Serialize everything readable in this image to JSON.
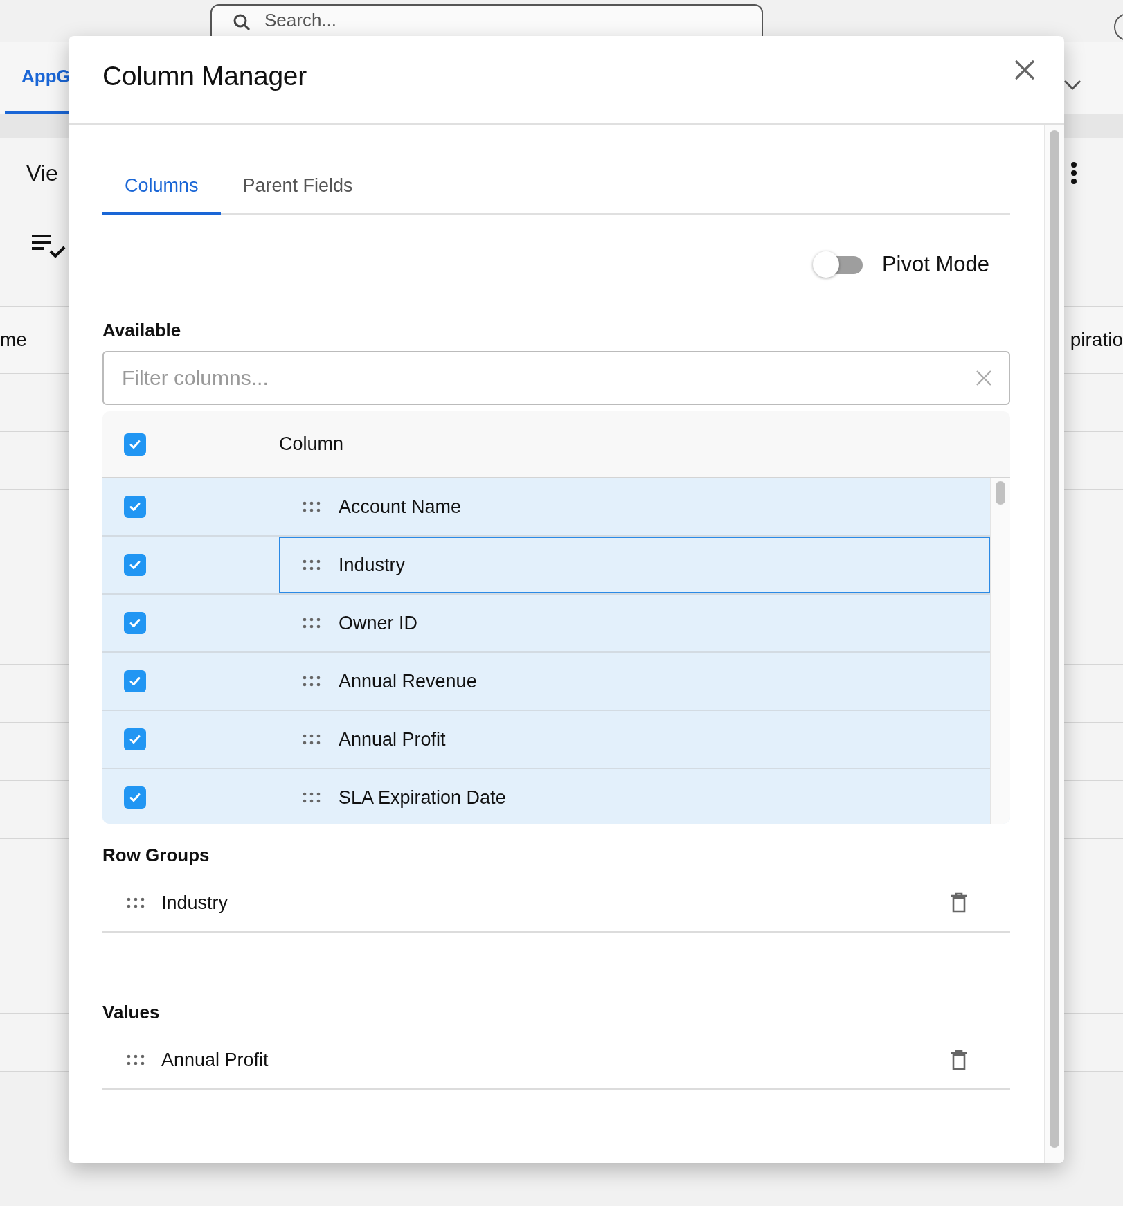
{
  "background": {
    "search": {
      "placeholder": "Search..."
    },
    "tab": {
      "label": "AppG",
      "selected": true
    },
    "toolbar_label": "Vie",
    "header_cells": [
      "me",
      "piratio"
    ]
  },
  "dialog": {
    "title": "Column Manager",
    "tabs": [
      {
        "label": "Columns",
        "selected": true
      },
      {
        "label": "Parent Fields",
        "selected": false
      }
    ],
    "pivot_mode": {
      "label": "Pivot Mode",
      "on": false
    },
    "available": {
      "label": "Available",
      "filter": {
        "placeholder": "Filter columns..."
      },
      "header": {
        "label": "Column",
        "checked": true
      },
      "rows": [
        {
          "label": "Account Name",
          "checked": true,
          "focused": false
        },
        {
          "label": "Industry",
          "checked": true,
          "focused": true
        },
        {
          "label": "Owner ID",
          "checked": true,
          "focused": false
        },
        {
          "label": "Annual Revenue",
          "checked": true,
          "focused": false
        },
        {
          "label": "Annual Profit",
          "checked": true,
          "focused": false
        },
        {
          "label": "SLA Expiration Date",
          "checked": true,
          "focused": false
        }
      ]
    },
    "row_groups": {
      "label": "Row Groups",
      "items": [
        "Industry"
      ]
    },
    "values": {
      "label": "Values",
      "items": [
        "Annual Profit"
      ]
    }
  }
}
